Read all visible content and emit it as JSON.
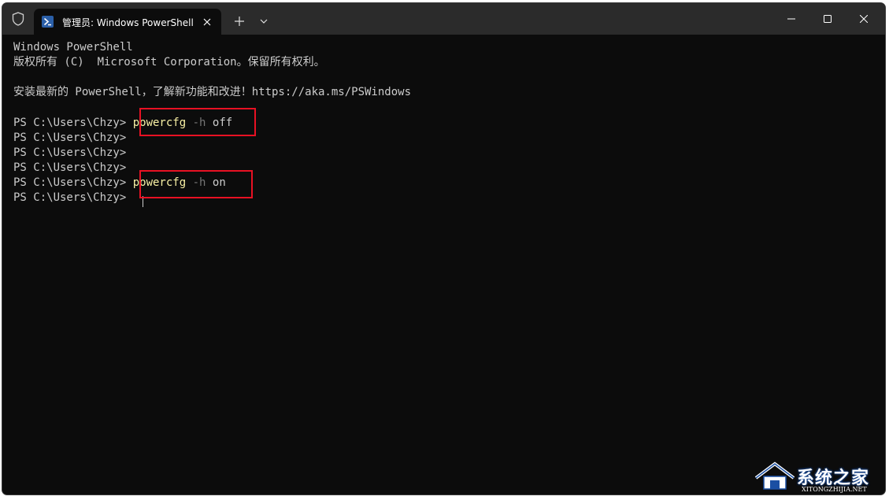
{
  "titlebar": {
    "tab_title": "管理员: Windows PowerShell",
    "icons": [
      "shield-icon",
      "powershell-icon",
      "close-icon",
      "plus-icon",
      "chevron-down-icon",
      "minimize-icon",
      "maximize-icon",
      "close-icon"
    ]
  },
  "console": {
    "line1": "Windows PowerShell",
    "line2": "版权所有 (C)  Microsoft Corporation。保留所有权利。",
    "line3": "安装最新的 PowerShell，了解新功能和改进！https://aka.ms/PSWindows",
    "prompt": "PS C:\\Users\\Chzy> ",
    "cmd1": {
      "exe": "powercfg",
      "param": "-h",
      "arg": "off"
    },
    "cmd2": {
      "exe": "powercfg",
      "param": "-h",
      "arg": "on"
    }
  },
  "colors": {
    "background": "#0c0c0c",
    "titlebar": "#2b2b2b",
    "text": "#cccccc",
    "command": "#f9f1a5",
    "parameter": "#767676",
    "highlight": "#e81123"
  },
  "watermark": {
    "title": "系统之家",
    "subtitle": "XITONGZHIJIA.NET"
  }
}
